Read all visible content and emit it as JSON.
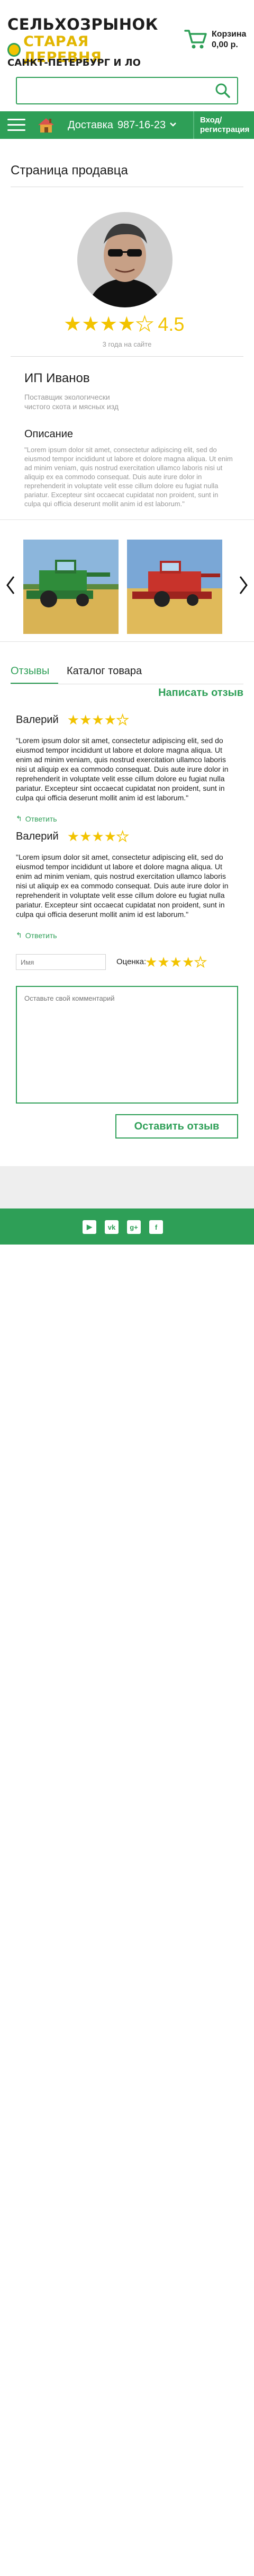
{
  "header": {
    "logo_line1": "СЕЛЬХОЗРЫНОК",
    "logo_line2": "СТАРАЯ ДЕРЕВНЯ",
    "city": "САНКТ-ПЕТЕРБУРГ И ЛО",
    "cart_label": "Корзина",
    "cart_sum": "0,00 р.",
    "search_placeholder": ""
  },
  "navbar": {
    "delivery_label": "Доставка",
    "delivery_phone": "987-16-23",
    "login_line1": "Вход/",
    "login_line2": "регистрация"
  },
  "page": {
    "title": "Страница продавца"
  },
  "seller": {
    "rating": "4.5",
    "rating_stars_filled": 4,
    "years_on_site": "3 года на сайте",
    "name": "ИП Иванов",
    "subtitle": "Поставщик экологически чистого скота и мясных изд",
    "description_title": "Описание",
    "description": "\"Lorem ipsum dolor sit amet, consectetur adipiscing elit, sed do eiusmod tempor incididunt ut labore et dolore magna aliqua. Ut enim ad minim veniam, quis nostrud exercitation ullamco laboris nisi ut aliquip ex ea commodo consequat. Duis aute irure dolor in reprehenderit in voluptate velit esse cillum dolore eu fugiat nulla pariatur. Excepteur sint occaecat cupidatat non proident, sunt in culpa qui officia deserunt mollit anim id est laborum.\""
  },
  "tabs": {
    "reviews": "Отзывы",
    "catalog": "Каталог товара",
    "write_review": "Написать отзыв"
  },
  "reviews": [
    {
      "author": "Валерий",
      "stars_filled": 4,
      "text": "\"Lorem ipsum dolor sit amet, consectetur adipiscing elit, sed do eiusmod tempor incididunt ut labore et dolore magna aliqua. Ut enim ad minim veniam, quis nostrud exercitation ullamco laboris nisi ut aliquip ex ea commodo consequat. Duis aute irure dolor in reprehenderit in voluptate velit esse cillum dolore eu fugiat nulla pariatur. Excepteur sint occaecat cupidatat non proident, sunt in culpa qui officia deserunt mollit anim id est laborum.\"",
      "reply": "Ответить"
    },
    {
      "author": "Валерий",
      "stars_filled": 4,
      "text": "\"Lorem ipsum dolor sit amet, consectetur adipiscing elit, sed do eiusmod tempor incididunt ut labore et dolore magna aliqua. Ut enim ad minim veniam, quis nostrud exercitation ullamco laboris nisi ut aliquip ex ea commodo consequat. Duis aute irure dolor in reprehenderit in voluptate velit esse cillum dolore eu fugiat nulla pariatur. Excepteur sint occaecat cupidatat non proident, sunt in culpa qui officia deserunt mollit anim id est laborum.\"",
      "reply": "Ответить"
    }
  ],
  "review_form": {
    "name_placeholder": "Имя",
    "rating_label": "Оценка:",
    "stars_filled": 4,
    "comment_placeholder": "Оставьте свой комментарий",
    "submit_label": "Оставить отзыв"
  },
  "footer": {
    "socials": [
      "youtube-icon",
      "vk-icon",
      "google-plus-icon",
      "facebook-icon"
    ],
    "social_labels": [
      "▶",
      "vk",
      "g+",
      "f"
    ]
  },
  "colors": {
    "brand_green": "#2e9f57",
    "star_yellow": "#f2c300",
    "logo_yellow": "#e2b600"
  }
}
